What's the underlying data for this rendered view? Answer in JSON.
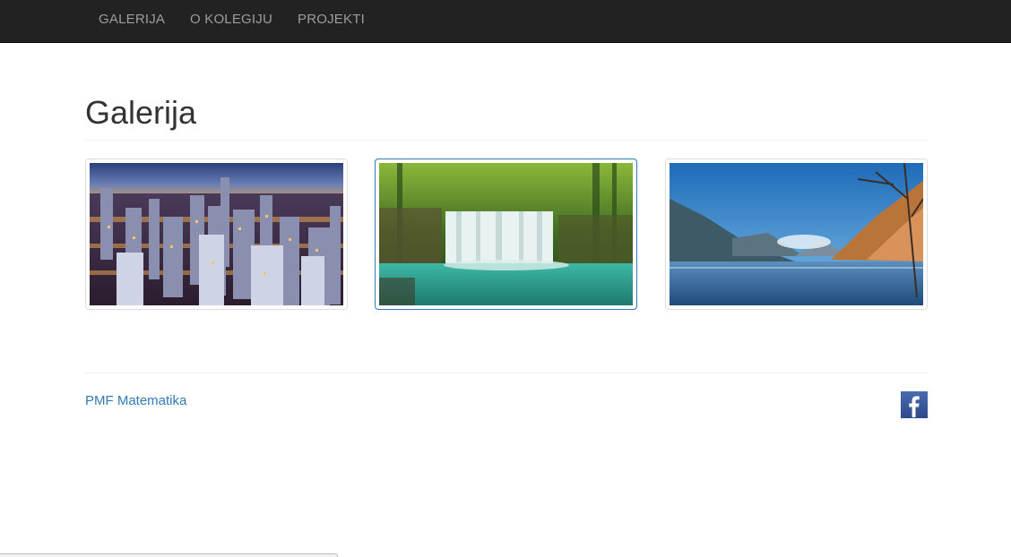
{
  "navbar": {
    "items": [
      {
        "label": "GALERIJA"
      },
      {
        "label": "O KOLEGIJU"
      },
      {
        "label": "PROJEKTI"
      }
    ]
  },
  "main": {
    "title": "Galerija",
    "gallery": [
      {
        "name": "city-night-thumbnail",
        "active": false
      },
      {
        "name": "waterfall-thumbnail",
        "active": true
      },
      {
        "name": "mountain-lake-thumbnail",
        "active": false
      }
    ]
  },
  "footer": {
    "link_label": "PMF Matematika",
    "social_icon": "facebook-icon"
  },
  "colors": {
    "navbar_bg": "#222222",
    "nav_text": "#9d9d9d",
    "link": "#337ab7",
    "facebook": "#3b5998"
  }
}
